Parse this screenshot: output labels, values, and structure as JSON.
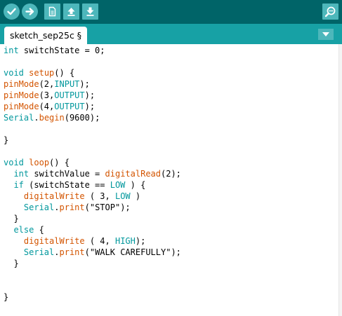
{
  "toolbar": {
    "buttons": [
      {
        "icon": "checkmark-icon",
        "label": "Verify"
      },
      {
        "icon": "arrow-right-icon",
        "label": "Upload"
      },
      {
        "icon": "new-document-icon",
        "label": "New"
      },
      {
        "icon": "arrow-up-icon",
        "label": "Open"
      },
      {
        "icon": "arrow-down-icon",
        "label": "Save"
      },
      {
        "icon": "serial-monitor-icon",
        "label": "Serial Monitor"
      }
    ]
  },
  "tabs": [
    {
      "label": "sketch_sep25c §",
      "active": true
    }
  ],
  "tab_menu_icon": "triangle-down-icon",
  "colors": {
    "toolbar_bg": "#006468",
    "tabbar_bg": "#17a1a5",
    "button_bg": "#4db7bb",
    "keyword": "#00979c",
    "function": "#d35400"
  },
  "code": {
    "lines": [
      [
        {
          "t": "int",
          "c": "kw"
        },
        {
          "t": " switchState = 0;"
        }
      ],
      [],
      [
        {
          "t": "void",
          "c": "kw"
        },
        {
          "t": " "
        },
        {
          "t": "setup",
          "c": "fn"
        },
        {
          "t": "() {"
        }
      ],
      [
        {
          "t": "pinMode",
          "c": "fn"
        },
        {
          "t": "(2,"
        },
        {
          "t": "INPUT",
          "c": "kw"
        },
        {
          "t": ");"
        }
      ],
      [
        {
          "t": "pinMode",
          "c": "fn"
        },
        {
          "t": "(3,"
        },
        {
          "t": "OUTPUT",
          "c": "kw"
        },
        {
          "t": ");"
        }
      ],
      [
        {
          "t": "pinMode",
          "c": "fn"
        },
        {
          "t": "(4,"
        },
        {
          "t": "OUTPUT",
          "c": "kw"
        },
        {
          "t": ");"
        }
      ],
      [
        {
          "t": "Serial",
          "c": "kw"
        },
        {
          "t": "."
        },
        {
          "t": "begin",
          "c": "fn"
        },
        {
          "t": "(9600);"
        }
      ],
      [],
      [
        {
          "t": "}"
        }
      ],
      [],
      [
        {
          "t": "void",
          "c": "kw"
        },
        {
          "t": " "
        },
        {
          "t": "loop",
          "c": "fn"
        },
        {
          "t": "() {"
        }
      ],
      [
        {
          "t": "  "
        },
        {
          "t": "int",
          "c": "kw"
        },
        {
          "t": " switchValue = "
        },
        {
          "t": "digitalRead",
          "c": "fn"
        },
        {
          "t": "(2);"
        }
      ],
      [
        {
          "t": "  "
        },
        {
          "t": "if",
          "c": "kw"
        },
        {
          "t": " (switchState == "
        },
        {
          "t": "LOW",
          "c": "kw"
        },
        {
          "t": " ) {"
        }
      ],
      [
        {
          "t": "    "
        },
        {
          "t": "digitalWrite",
          "c": "fn"
        },
        {
          "t": " ( 3, "
        },
        {
          "t": "LOW",
          "c": "kw"
        },
        {
          "t": " )"
        }
      ],
      [
        {
          "t": "    "
        },
        {
          "t": "Serial",
          "c": "kw"
        },
        {
          "t": "."
        },
        {
          "t": "print",
          "c": "fn"
        },
        {
          "t": "(\"STOP\");"
        }
      ],
      [
        {
          "t": "  }"
        }
      ],
      [
        {
          "t": "  "
        },
        {
          "t": "else",
          "c": "kw"
        },
        {
          "t": " {"
        }
      ],
      [
        {
          "t": "    "
        },
        {
          "t": "digitalWrite",
          "c": "fn"
        },
        {
          "t": " ( 4, "
        },
        {
          "t": "HIGH",
          "c": "kw"
        },
        {
          "t": ");"
        }
      ],
      [
        {
          "t": "    "
        },
        {
          "t": "Serial",
          "c": "kw"
        },
        {
          "t": "."
        },
        {
          "t": "print",
          "c": "fn"
        },
        {
          "t": "(\"WALK CAREFULLY\");"
        }
      ],
      [
        {
          "t": "  }"
        }
      ],
      [],
      [],
      [
        {
          "t": "}"
        }
      ]
    ]
  }
}
